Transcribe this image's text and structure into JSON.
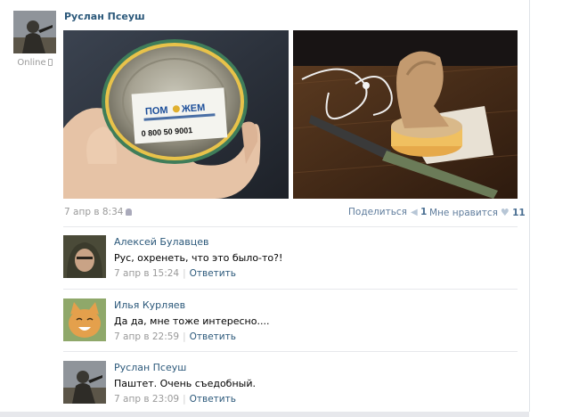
{
  "post": {
    "author": "Руслан Псеуш",
    "status": "Online",
    "date": "7 апр в 8:34",
    "share_label": "Поделиться",
    "share_count": "1",
    "like_label": "Мне нравится",
    "like_count": "11",
    "photos": [
      {
        "sticker_brand": "ПОМ",
        "sticker_brand2": "ЖЕМ",
        "sticker_phone": "0 800 50 9001"
      },
      {}
    ]
  },
  "comments": [
    {
      "author": "Алексей Булавцев",
      "text": "Рус, охренеть, что это было-то?!",
      "date": "7 апр в 15:24",
      "reply": "Ответить"
    },
    {
      "author": "Илья Курляев",
      "text": "Да да, мне тоже интересно....",
      "date": "7 апр в 22:59",
      "reply": "Ответить"
    },
    {
      "author": "Руслан Псеуш",
      "text": "Паштет. Очень съедобный.",
      "date": "7 апр в 23:09",
      "reply": "Ответить"
    }
  ],
  "colors": {
    "link": "#2b587a",
    "muted": "#999999",
    "action": "#5f7c9c",
    "divider": "#e7e8ec"
  },
  "icons": {
    "online_device": "mobile-phone-icon",
    "post_device": "android-icon",
    "share": "megaphone-icon",
    "like": "heart-icon"
  }
}
